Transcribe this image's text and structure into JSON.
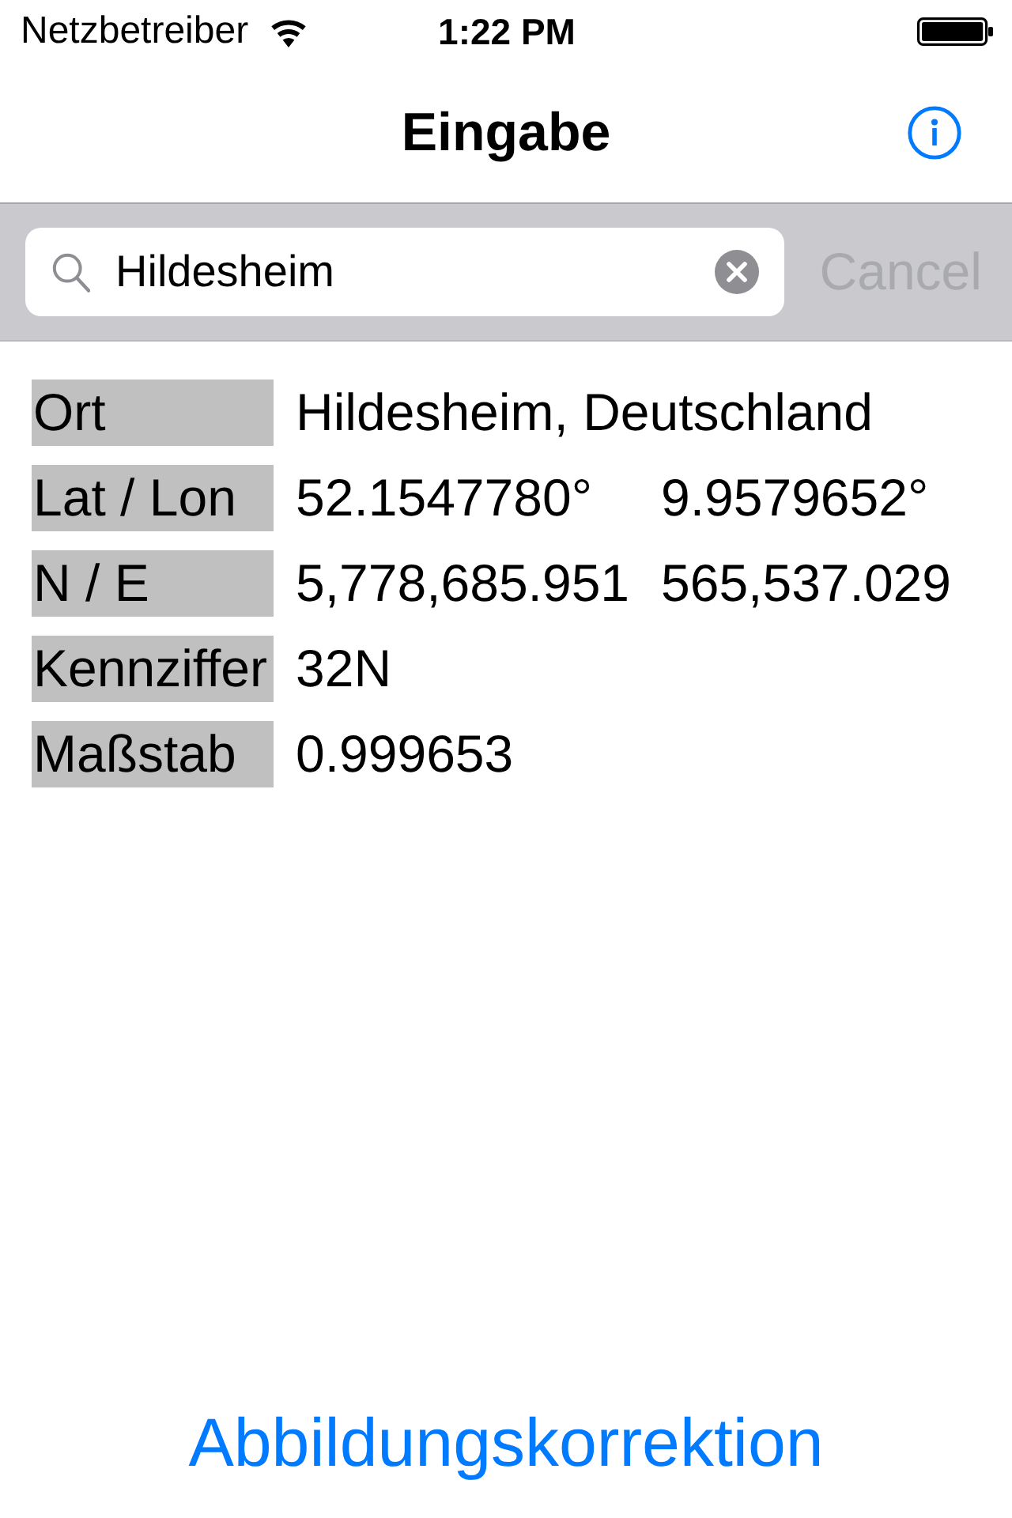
{
  "status_bar": {
    "carrier": "Netzbetreiber",
    "time": "1:22 PM"
  },
  "nav_bar": {
    "title": "Eingabe"
  },
  "search_bar": {
    "value": "Hildesheim",
    "cancel": {
      "label": "Cancel",
      "disabled": true
    }
  },
  "rows": [
    {
      "label": "Ort",
      "values": [
        "Hildesheim, Deutschland"
      ]
    },
    {
      "label": "Lat / Lon",
      "values": [
        "52.1547780°",
        "9.9579652°"
      ]
    },
    {
      "label": "N / E",
      "values": [
        "5,778,685.951",
        "565,537.029"
      ]
    },
    {
      "label": "Kennziffer",
      "values": [
        "32N"
      ]
    },
    {
      "label": "Maßstab",
      "values": [
        "0.999653"
      ]
    }
  ],
  "footer_button": {
    "label": "Abbildungskorrektion"
  }
}
